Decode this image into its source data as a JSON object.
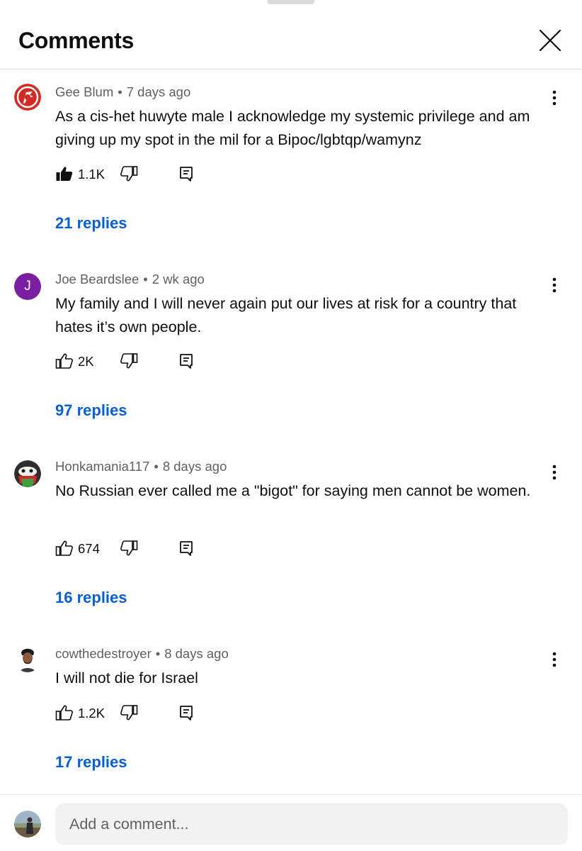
{
  "header": {
    "title": "Comments"
  },
  "comments": [
    {
      "author": "Gee Blum",
      "time": "7 days ago",
      "text": "As a cis-het huwyte male I acknowledge my systemic privilege and am giving up my spot in the mil for a Bipoc/lgbtqp/wamynz",
      "likes": "1.1K",
      "liked": true,
      "replies": "21 replies",
      "avatar_icon": "red-emblem-avatar"
    },
    {
      "author": "Joe Beardslee",
      "time": "2 wk ago",
      "text": "My family and I will never again put our lives at risk for a country that hates it’s own people.",
      "likes": "2K",
      "liked": false,
      "replies": "97 replies",
      "avatar_letter": "J",
      "avatar_color": "#7b1fa2"
    },
    {
      "author": "Honkamania117",
      "time": "8 days ago",
      "text": "No Russian ever called me a \"bigot\" for saying men cannot be women.",
      "likes": "674",
      "liked": false,
      "replies": "16 replies",
      "avatar_icon": "cartoon-frog-avatar"
    },
    {
      "author": "cowthedestroyer",
      "time": "8 days ago",
      "text": "I will not die for Israel",
      "likes": "1.2K",
      "liked": false,
      "replies": "17 replies",
      "avatar_icon": "person-photo-avatar"
    }
  ],
  "footer": {
    "placeholder": "Add a comment...",
    "avatar_icon": "user-photo-avatar"
  },
  "colors": {
    "link": "#065fd4",
    "meta": "#606060",
    "text": "#0f0f0f",
    "input_bg": "#f2f2f2"
  }
}
